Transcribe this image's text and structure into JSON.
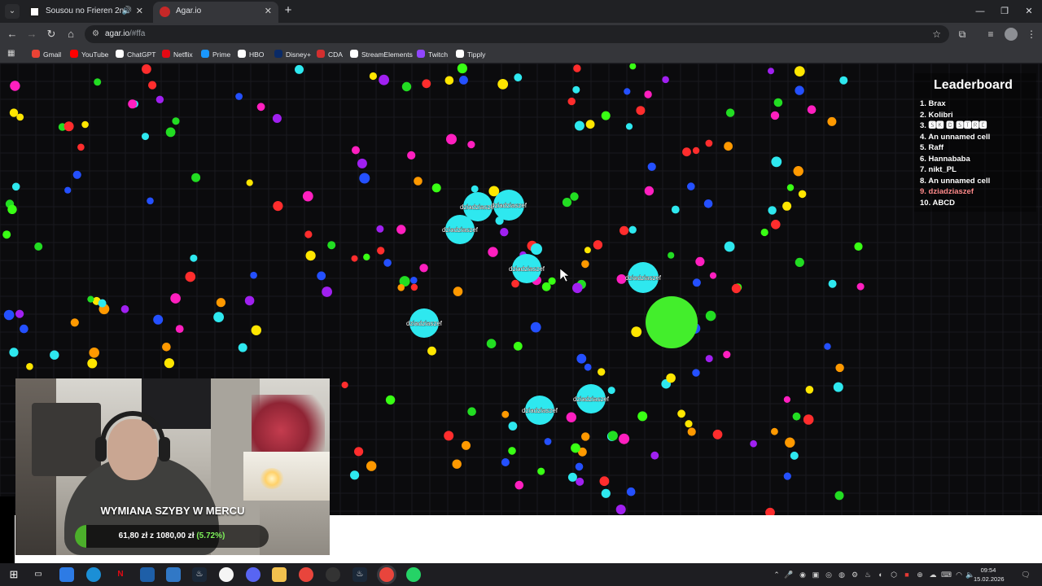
{
  "browser": {
    "tabs": [
      {
        "title": "Sousou no Frieren 2nd Sea",
        "active": false,
        "audio": true
      },
      {
        "title": "Agar.io",
        "active": true,
        "audio": false
      }
    ],
    "new_tab": "+",
    "window_controls": {
      "minimize": "—",
      "maximize": "❐",
      "close": "✕"
    },
    "url": {
      "host": "agar.io",
      "path": "/#ffa"
    },
    "bookmarks": [
      "Gmail",
      "YouTube",
      "ChatGPT",
      "Netflix",
      "Prime",
      "HBO",
      "Disney+",
      "CDA",
      "StreamElements",
      "Twitch",
      "Tipply"
    ],
    "bookmark_icon_colors": [
      "#ea4335",
      "#ff0000",
      "#ffffff",
      "#e50914",
      "#1a98ff",
      "#ffffff",
      "#0a2a66",
      "#d32f2f",
      "#ffffff",
      "#9146ff",
      "#ffffff"
    ]
  },
  "game": {
    "player_name": "dziadziaszef",
    "player_cells": 9,
    "player_color": "#2ee8ef",
    "enemy_color": "#43ee2c",
    "food_colors": [
      "#39ff14",
      "#ffe600",
      "#ff2d2d",
      "#2ee8ef",
      "#a020f0",
      "#ff1fbf",
      "#ff9900",
      "#2450ff",
      "#22dd22",
      "#ffffff"
    ],
    "leaderboard": {
      "title": "Leaderboard",
      "entries": [
        "1. Brax",
        "2. Kolibri",
        "3. 🆂🅺 🅱 🆂🆃🆁🅴",
        "4. An unnamed cell",
        "5. Raff",
        "6. Hannababa",
        "7. nikt_PL",
        "8. An unnamed cell",
        "9. dziadziaszef",
        "10. ABCD"
      ],
      "highlight_index": 8,
      "highlight_color": "#ff8a8a"
    }
  },
  "stream_overlay": {
    "goal_title": "WYMIANA SZYBY W MERCU",
    "goal_raised": "61,80 zł",
    "goal_separator": "z",
    "goal_target": "1080,00 zł",
    "goal_percent": "(5.72%)",
    "goal_fraction": 0.0572
  },
  "taskbar": {
    "time": "09:54",
    "date": "15.02.2026"
  }
}
